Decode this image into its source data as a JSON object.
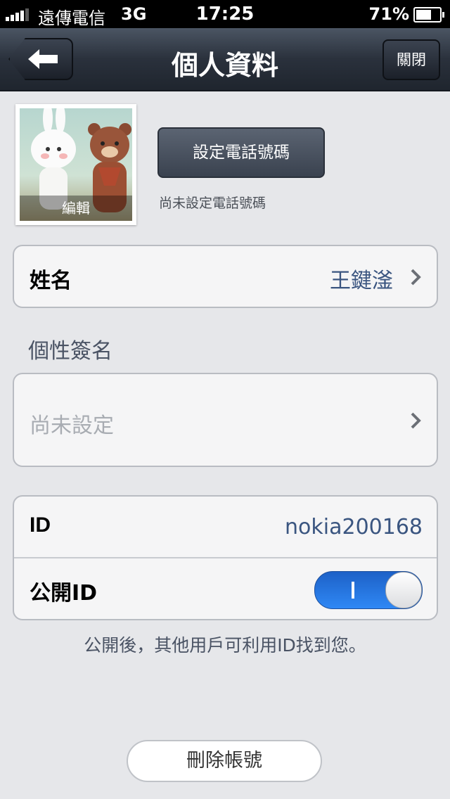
{
  "status_bar": {
    "carrier": "遠傳電信",
    "network": "3G",
    "time": "17:25",
    "battery": "71%",
    "battery_level": 0.71
  },
  "nav": {
    "back_icon": "back-arrow-icon",
    "title": "個人資料",
    "close_label": "關閉"
  },
  "profile": {
    "avatar_edit_label": "編輯",
    "set_phone_label": "設定電話號碼",
    "phone_status": "尚未設定電話號碼"
  },
  "name_row": {
    "label": "姓名",
    "value": "王鍵滏"
  },
  "signature": {
    "section_title": "個性簽名",
    "placeholder": "尚未設定"
  },
  "id_section": {
    "id_label": "ID",
    "id_value": "nokia200168",
    "public_label": "公開ID",
    "public_enabled": true,
    "footnote": "公開後，其他用戶可利用ID找到您。"
  },
  "delete_label": "刪除帳號",
  "colors": {
    "nav_dark": "#2a313c",
    "value_blue": "#3a5580",
    "toggle_blue": "#2f88f5",
    "background": "#e6e7ea"
  }
}
